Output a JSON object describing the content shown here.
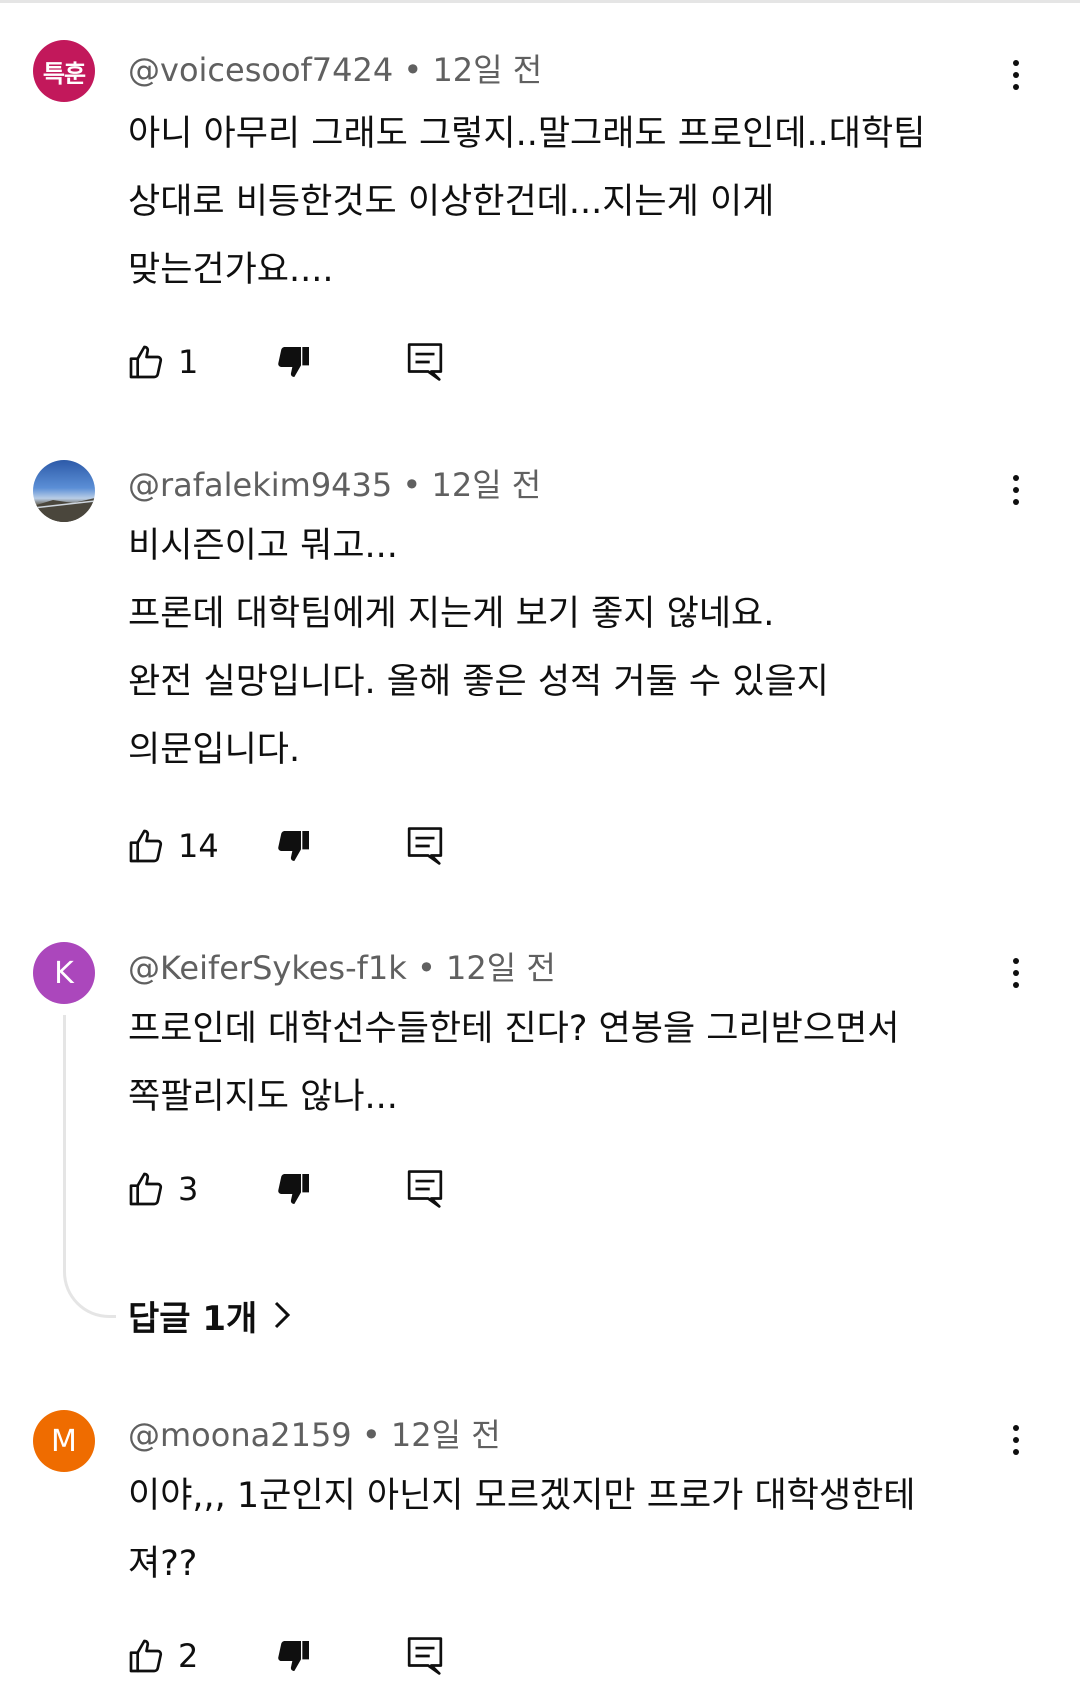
{
  "comments": [
    {
      "avatar_text": "특훈",
      "avatar_color": "#c2185b",
      "handle": "@voicesoof7424",
      "time": "12일 전",
      "text": "아니 아무리 그래도 그렇지..말그래도 프로인데..대학팀\n상대로 비등한것도 이상한건데...지는게 이게\n맞는건가요....",
      "likes": "1"
    },
    {
      "avatar_text": "",
      "avatar_image": "landscape-photo",
      "handle": "@rafalekim9435",
      "time": "12일 전",
      "text": "비시즌이고 뭐고...\n프론데 대학팀에게 지는게 보기 좋지 않네요.\n완전 실망입니다. 올해 좋은 성적 거둘 수 있을지\n의문입니다.",
      "likes": "14"
    },
    {
      "avatar_text": "K",
      "avatar_color": "#ab47bc",
      "handle": "@KeiferSykes-f1k",
      "time": "12일 전",
      "text": "프로인데 대학선수들한테 진다? 연봉을 그리받으면서\n쪽팔리지도 않나...",
      "likes": "3",
      "replies_label": "답글 1개"
    },
    {
      "avatar_text": "M",
      "avatar_color": "#ef6c00",
      "handle": "@moona2159",
      "time": "12일 전",
      "text": "이야,,, 1군인지 아닌지 모르겠지만 프로가 대학생한테\n져??",
      "likes": "2"
    }
  ],
  "separator": " • ",
  "icons": {
    "like": "thumbs-up-icon",
    "dislike": "thumbs-down-icon",
    "reply": "comment-reply-icon",
    "more": "more-vertical-icon",
    "chevron": "chevron-right-icon"
  }
}
